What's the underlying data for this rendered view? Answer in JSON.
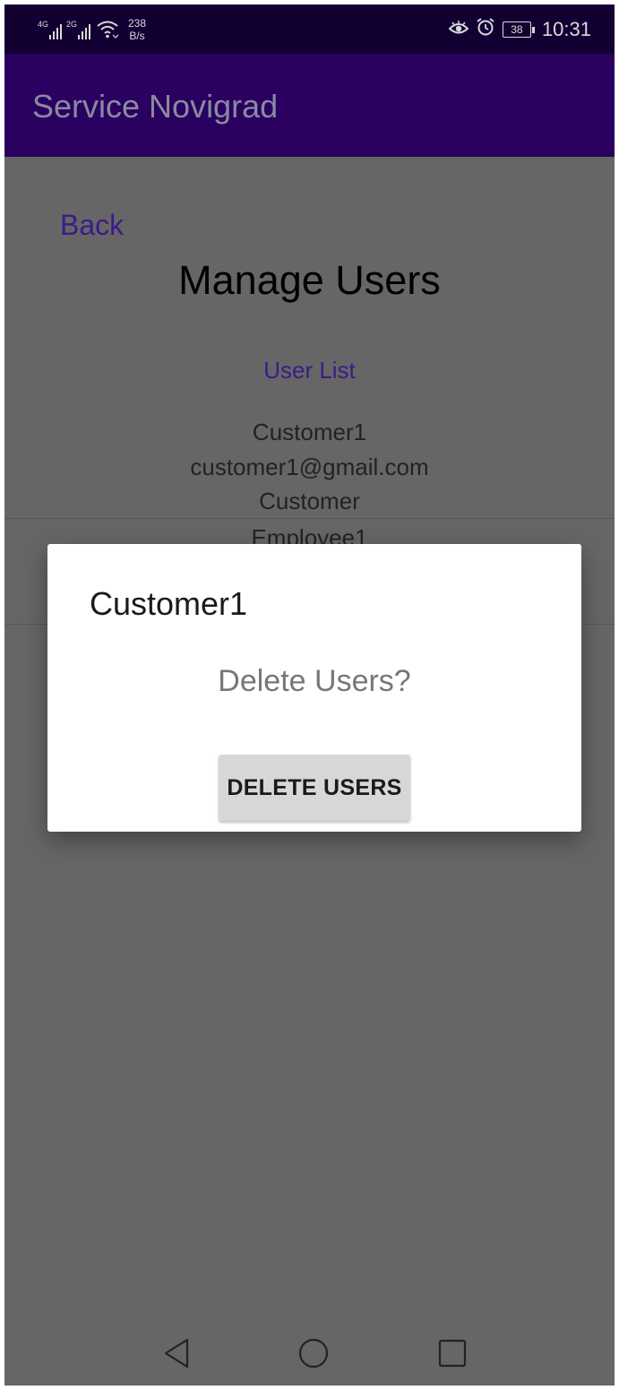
{
  "status_bar": {
    "signal1_label": "4G",
    "signal2_label": "2G",
    "net_speed_value": "238",
    "net_speed_unit": "B/s",
    "battery_level": "38",
    "time": "10:31",
    "icons": [
      "signal-4g-icon",
      "signal-2g-icon",
      "wifi-icon",
      "eye-comfort-icon",
      "alarm-icon",
      "battery-icon"
    ]
  },
  "app_bar": {
    "title": "Service Novigrad"
  },
  "page": {
    "back_label": "Back",
    "title": "Manage Users",
    "list_label": "User List"
  },
  "users": [
    {
      "name": "Customer1",
      "email": "customer1@gmail.com",
      "role": "Customer"
    },
    {
      "name": "Employee1"
    }
  ],
  "dialog": {
    "title": "Customer1",
    "message": "Delete Users?",
    "button_label": "DELETE USERS"
  },
  "nav_bar": {
    "icons": [
      "back-triangle-icon",
      "home-circle-icon",
      "recents-square-icon"
    ]
  }
}
